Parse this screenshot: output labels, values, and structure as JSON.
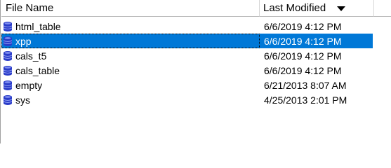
{
  "header": {
    "file_name_label": "File Name",
    "last_modified_label": "Last Modified",
    "sort_direction": "descending"
  },
  "colors": {
    "selection": "#0078d7",
    "icon": "#2a3cc8"
  },
  "files": [
    {
      "name": "html_table",
      "modified": "6/6/2019 4:12 PM",
      "icon": "database-icon",
      "selected": false
    },
    {
      "name": "xpp",
      "modified": "6/6/2019 4:12 PM",
      "icon": "database-icon",
      "selected": true
    },
    {
      "name": "cals_t5",
      "modified": "6/6/2019 4:12 PM",
      "icon": "database-icon",
      "selected": false
    },
    {
      "name": "cals_table",
      "modified": "6/6/2019 4:12 PM",
      "icon": "database-icon",
      "selected": false
    },
    {
      "name": "empty",
      "modified": "6/21/2013 8:07 AM",
      "icon": "database-icon",
      "selected": false
    },
    {
      "name": "sys",
      "modified": "4/25/2013 2:01 PM",
      "icon": "database-icon",
      "selected": false
    }
  ]
}
